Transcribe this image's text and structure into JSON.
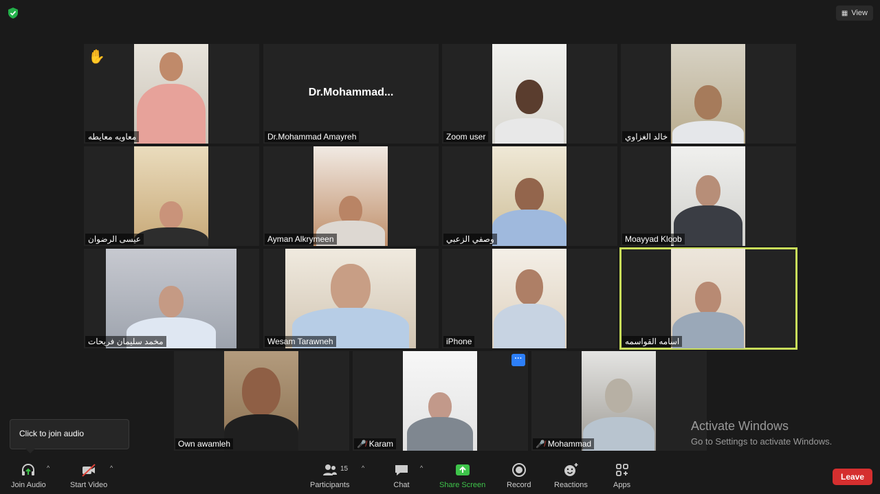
{
  "top": {
    "view_label": "View"
  },
  "tiles": [
    {
      "name": "معاويه معايطه",
      "rtl": true
    },
    {
      "name": "Dr.Mohammad Amayreh",
      "center": "Dr.Mohammad..."
    },
    {
      "name": "Zoom user"
    },
    {
      "name": "خالد الغزاوي",
      "rtl": true
    },
    {
      "name": "عيسى الرضوان",
      "rtl": true
    },
    {
      "name": "Ayman Alkrymeen"
    },
    {
      "name": "وصفي الزعبي",
      "rtl": true
    },
    {
      "name": "Moayyad Kloob"
    },
    {
      "name": "مخمد سليمان فريحات",
      "rtl": true
    },
    {
      "name": "Wesam Tarawneh"
    },
    {
      "name": "iPhone"
    },
    {
      "name": "اسامه القواسمه",
      "rtl": true
    },
    {
      "name": "Own awamleh"
    },
    {
      "name": "Karam"
    },
    {
      "name": "Mohammad"
    }
  ],
  "more_label": "···",
  "tooltip": "Click to join audio",
  "watermark": {
    "line1": "Activate Windows",
    "line2": "Go to Settings to activate Windows."
  },
  "toolbar": {
    "join_audio": "Join Audio",
    "start_video": "Start Video",
    "participants": "Participants",
    "participants_count": "15",
    "chat": "Chat",
    "share_screen": "Share Screen",
    "record": "Record",
    "reactions": "Reactions",
    "apps": "Apps",
    "leave": "Leave"
  },
  "colors": {
    "active_border": "#c9dd5a",
    "leave": "#d52f2f",
    "share": "#3ec44a",
    "muted": "#e0443a"
  }
}
